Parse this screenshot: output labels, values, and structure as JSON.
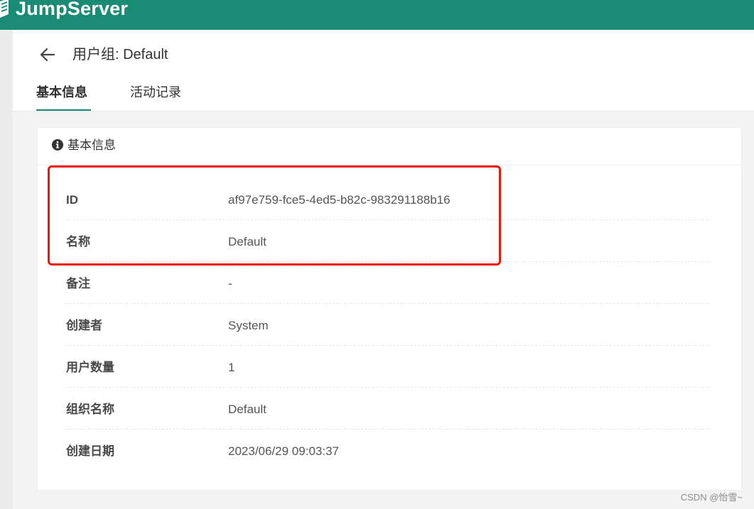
{
  "app": {
    "name": "JumpServer"
  },
  "header": {
    "title": "用户组: Default",
    "tabs": [
      {
        "label": "基本信息",
        "active": true
      },
      {
        "label": "活动记录",
        "active": false
      }
    ]
  },
  "card": {
    "title": "基本信息",
    "rows": [
      {
        "label": "ID",
        "value": "af97e759-fce5-4ed5-b82c-983291188b16"
      },
      {
        "label": "名称",
        "value": "Default"
      },
      {
        "label": "备注",
        "value": "-"
      },
      {
        "label": "创建者",
        "value": "System"
      },
      {
        "label": "用户数量",
        "value": "1"
      },
      {
        "label": "组织名称",
        "value": "Default"
      },
      {
        "label": "创建日期",
        "value": "2023/06/29 09:03:37"
      }
    ]
  },
  "watermark": "CSDN @怡雪~",
  "colors": {
    "brand": "#1a8c76",
    "annotation": "#f2140c"
  },
  "icons": {
    "back": "arrow-left-icon",
    "info": "info-circle-icon",
    "logo": "jumpserver-logo-icon"
  }
}
